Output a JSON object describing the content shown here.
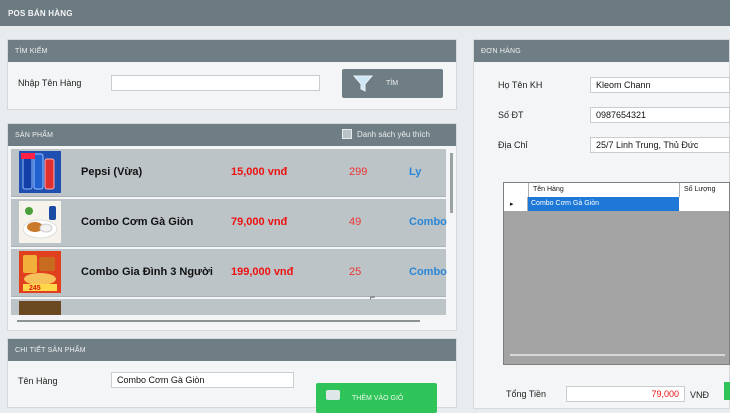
{
  "app": {
    "title": "POS BÁN HÀNG"
  },
  "search": {
    "header": "TÌM KIẾM",
    "label": "Nhập Tên Hàng",
    "value": "",
    "button": "TÌM"
  },
  "products": {
    "header": "SẢN PHẨM",
    "favorites_label": "Danh sách yêu thích",
    "items": [
      {
        "name": "Pepsi (Vừa)",
        "price": "15,000 vnđ",
        "qty": "299",
        "unit": "Ly"
      },
      {
        "name": "Combo Cơm Gà Giòn",
        "price": "79,000 vnđ",
        "qty": "49",
        "unit": "Combo"
      },
      {
        "name": "Combo Gia Đình 3 Người",
        "price": "199,000 vnđ",
        "qty": "25",
        "unit": "Combo"
      }
    ],
    "thumb3_text": "245"
  },
  "detail": {
    "header": "CHI TIẾT SẢN PHẨM",
    "name_label": "Tên Hàng",
    "name_value": "Combo Cơm Gà Giòn",
    "add_button": "THÊM VÀO GIỎ"
  },
  "order": {
    "header": "ĐƠN HÀNG",
    "name_label": "Họ Tên KH",
    "name_value": "Kleom Chann",
    "phone_label": "Số ĐT",
    "phone_value": "0987654321",
    "address_label": "Địa Chỉ",
    "address_value": "25/7 Linh Trung, Thủ Đức",
    "grid": {
      "columns": [
        "Tên Hàng",
        "Số Lượng"
      ],
      "current_row_marker": "▸",
      "rows": [
        {
          "name": "Combo Cơm Gà Giòn",
          "qty": ""
        }
      ]
    },
    "total_label": "Tổng Tiền",
    "total_value": "79,000",
    "currency": "VNĐ"
  },
  "colors": {
    "header_bg": "#6f7e84",
    "price_red": "#e11111",
    "unit_blue": "#2a86d6",
    "add_green": "#2ec45a",
    "selection_blue": "#1e78d7"
  }
}
